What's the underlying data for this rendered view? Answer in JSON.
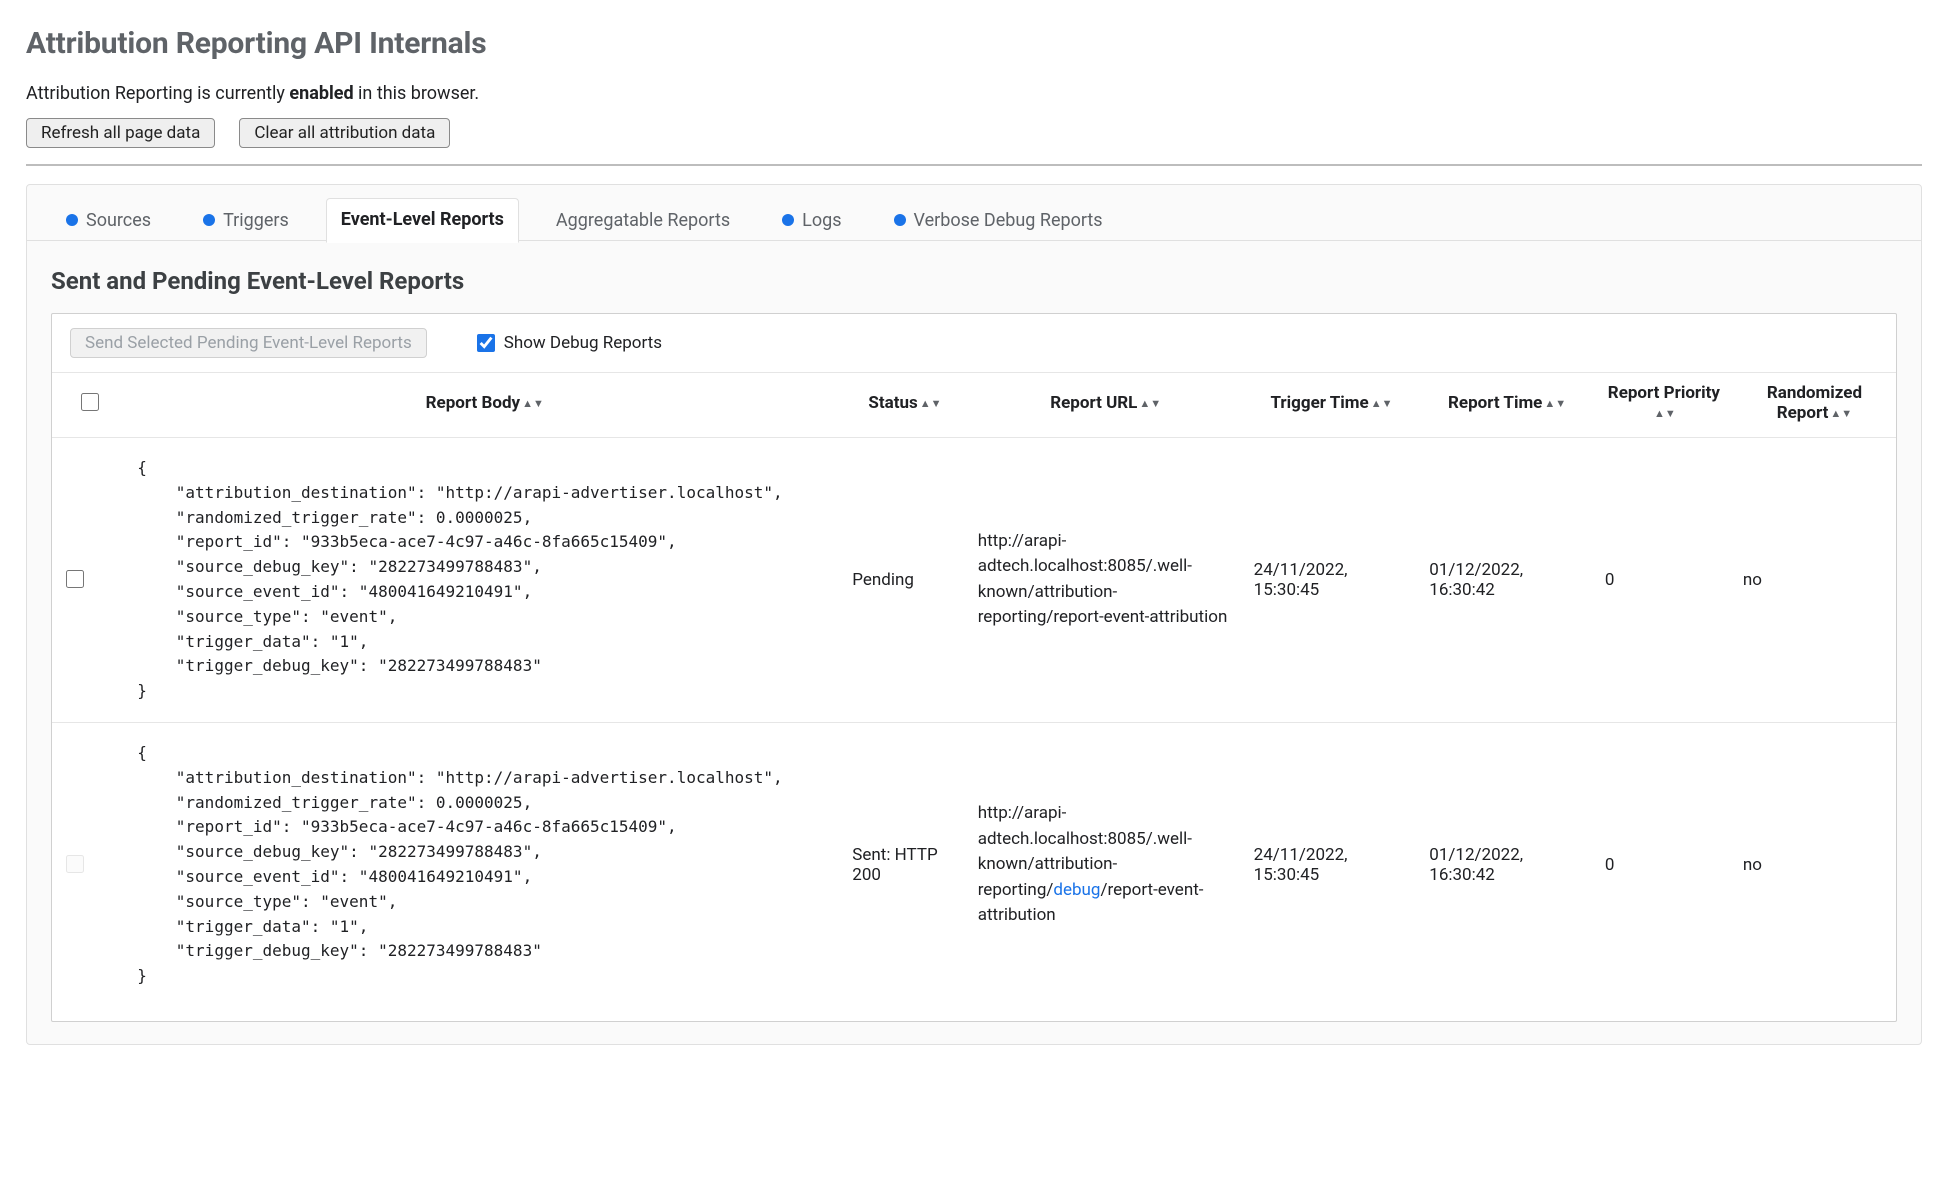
{
  "header": {
    "title": "Attribution Reporting API Internals",
    "status_prefix": "Attribution Reporting is currently ",
    "status_state": "enabled",
    "status_suffix": " in this browser.",
    "refresh_btn": "Refresh all page data",
    "clear_btn": "Clear all attribution data"
  },
  "tabs": {
    "sources": "Sources",
    "triggers": "Triggers",
    "event_reports": "Event-Level Reports",
    "agg_reports": "Aggregatable Reports",
    "logs": "Logs",
    "verbose": "Verbose Debug Reports"
  },
  "section": {
    "title": "Sent and Pending Event-Level Reports",
    "send_btn": "Send Selected Pending Event-Level Reports",
    "debug_label": "Show Debug Reports"
  },
  "columns": {
    "body": "Report Body",
    "status": "Status",
    "url": "Report URL",
    "trigger_time": "Trigger Time",
    "report_time": "Report Time",
    "priority": "Report Priority",
    "randomized": "Randomized Report"
  },
  "rows": [
    {
      "body": "{\n    \"attribution_destination\": \"http://arapi-advertiser.localhost\",\n    \"randomized_trigger_rate\": 0.0000025,\n    \"report_id\": \"933b5eca-ace7-4c97-a46c-8fa665c15409\",\n    \"source_debug_key\": \"282273499788483\",\n    \"source_event_id\": \"480041649210491\",\n    \"source_type\": \"event\",\n    \"trigger_data\": \"1\",\n    \"trigger_debug_key\": \"282273499788483\"\n}",
      "status": "Pending",
      "url_pre": "http://arapi-adtech.localhost:8085/.well-known/attribution-reporting/report-event-attribution",
      "url_debug": "",
      "url_post": "",
      "trigger_time": "24/11/2022, 15:30:45",
      "report_time": "01/12/2022, 16:30:42",
      "priority": "0",
      "randomized": "no",
      "checkbox_disabled": false
    },
    {
      "body": "{\n    \"attribution_destination\": \"http://arapi-advertiser.localhost\",\n    \"randomized_trigger_rate\": 0.0000025,\n    \"report_id\": \"933b5eca-ace7-4c97-a46c-8fa665c15409\",\n    \"source_debug_key\": \"282273499788483\",\n    \"source_event_id\": \"480041649210491\",\n    \"source_type\": \"event\",\n    \"trigger_data\": \"1\",\n    \"trigger_debug_key\": \"282273499788483\"\n}",
      "status": "Sent: HTTP 200",
      "url_pre": "http://arapi-adtech.localhost:8085/.well-known/attribution-reporting/",
      "url_debug": "debug",
      "url_post": "/report-event-attribution",
      "trigger_time": "24/11/2022, 15:30:45",
      "report_time": "01/12/2022, 16:30:42",
      "priority": "0",
      "randomized": "no",
      "checkbox_disabled": true
    }
  ]
}
